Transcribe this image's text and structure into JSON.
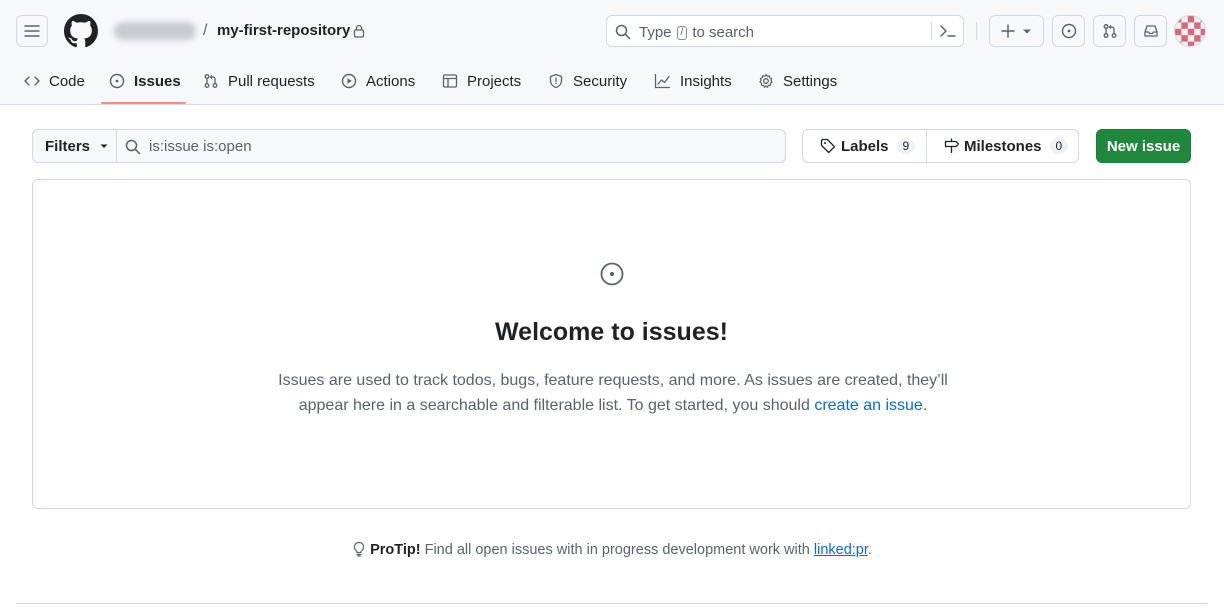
{
  "header": {
    "repo_name": "my-first-repository",
    "separator": "/",
    "search_prefix": "Type",
    "search_key": "/",
    "search_suffix": "to search"
  },
  "tabs": [
    {
      "label": "Code",
      "icon": "code-icon"
    },
    {
      "label": "Issues",
      "icon": "issue-opened-icon",
      "active": true
    },
    {
      "label": "Pull requests",
      "icon": "git-pull-request-icon"
    },
    {
      "label": "Actions",
      "icon": "play-icon"
    },
    {
      "label": "Projects",
      "icon": "table-icon"
    },
    {
      "label": "Security",
      "icon": "shield-icon"
    },
    {
      "label": "Insights",
      "icon": "graph-icon"
    },
    {
      "label": "Settings",
      "icon": "gear-icon"
    }
  ],
  "subnav": {
    "filters_label": "Filters",
    "query_value": "is:issue is:open",
    "labels_label": "Labels",
    "labels_count": "9",
    "milestones_label": "Milestones",
    "milestones_count": "0",
    "new_issue_label": "New issue"
  },
  "blankslate": {
    "title": "Welcome to issues!",
    "description_line1": "Issues are used to track todos, bugs, feature requests, and more. As issues are created, they’ll",
    "description_line2": "appear here in a searchable and filterable list. To get started, you should",
    "link_text": "create an issue",
    "after_link": "."
  },
  "protip": {
    "label": "ProTip!",
    "text": "Find all open issues with in progress development work with",
    "link": "linked:pr",
    "after_link": "."
  },
  "colors": {
    "accent_green": "#1f883d",
    "link_blue": "#0969da",
    "tab_underline": "#fd8c73"
  }
}
